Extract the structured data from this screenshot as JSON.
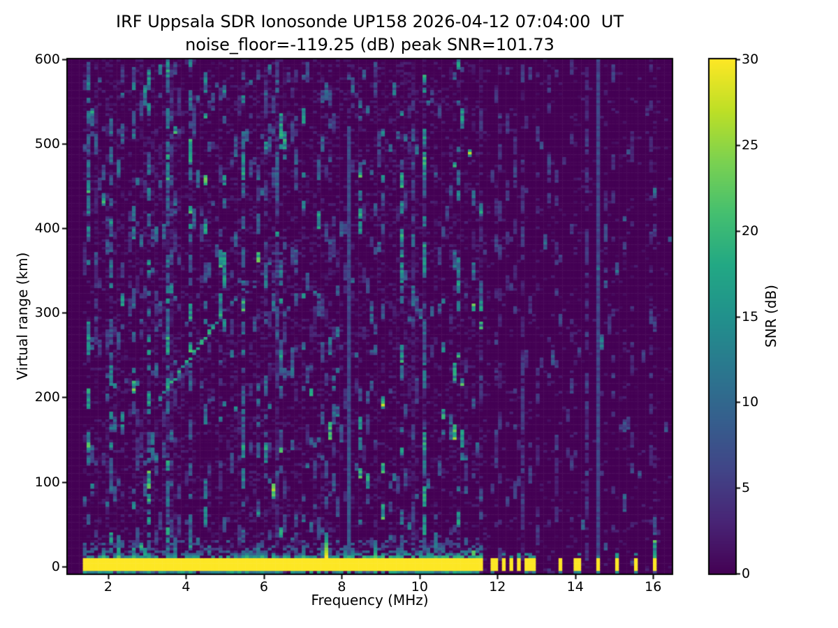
{
  "figure": {
    "background": "#ffffff",
    "text_color": "#000000"
  },
  "chart_data": {
    "type": "heatmap",
    "title": "IRF Uppsala SDR Ionosonde UP158 2026-04-12 07:04:00  UT",
    "subtitle": "noise_floor=-119.25 (dB) peak SNR=101.73",
    "noise_floor_db": -119.25,
    "peak_snr_db": 101.73,
    "xlabel": "Frequency (MHz)",
    "ylabel": "Virtual range (km)",
    "xlim": [
      0.96,
      16.48
    ],
    "ylim": [
      -8.5,
      600
    ],
    "x_ticks": [
      2,
      4,
      6,
      8,
      10,
      12,
      14,
      16
    ],
    "y_ticks": [
      0,
      100,
      200,
      300,
      400,
      500,
      600
    ],
    "grid": false,
    "colorbar": {
      "label": "SNR (dB)",
      "vmin": 0,
      "vmax": 30,
      "ticks": [
        0,
        5,
        10,
        15,
        20,
        25,
        30
      ],
      "position": "right"
    },
    "colormap": {
      "name": "viridis",
      "stops": [
        {
          "t": 0.0,
          "color": "#440154"
        },
        {
          "t": 0.1,
          "color": "#482475"
        },
        {
          "t": 0.2,
          "color": "#414487"
        },
        {
          "t": 0.3,
          "color": "#355f8d"
        },
        {
          "t": 0.4,
          "color": "#2a788e"
        },
        {
          "t": 0.5,
          "color": "#21918c"
        },
        {
          "t": 0.6,
          "color": "#22a884"
        },
        {
          "t": 0.7,
          "color": "#44bf70"
        },
        {
          "t": 0.8,
          "color": "#7ad151"
        },
        {
          "t": 0.9,
          "color": "#bddf26"
        },
        {
          "t": 1.0,
          "color": "#fde725"
        }
      ]
    },
    "features": {
      "description": "Ionogram: dark viridis noise field with speckled vertical interference streaks, saturated yellow ground-pulse band near 0 km, discrete transmit blocks above 11.6 MHz, oblique ionospheric echo trace, and narrow RFI lines.",
      "sweep_start_mhz": 1.35,
      "ground_pulse_band": {
        "f_range_mhz": [
          1.35,
          11.63
        ],
        "virtual_range_km": [
          -5.5,
          9
        ],
        "snr_db": 30
      },
      "band_fringe": {
        "f_range_mhz": [
          8.0,
          11.63
        ],
        "extends_to_km": 30
      },
      "bottom_edge_line_km": -7,
      "discrete_tx_blocks_mhz": [
        11.93,
        12.15,
        12.36,
        12.57,
        12.78,
        12.95,
        13.63,
        14.06,
        14.57,
        15.07,
        15.55,
        16.02
      ],
      "ground_spike": {
        "f_mhz": 7.63,
        "top_km": 40,
        "snr_db": 30
      },
      "echo_trace_points": [
        {
          "f_mhz": 3.3,
          "range_km": 196
        },
        {
          "f_mhz": 4.96,
          "range_km": 300
        },
        {
          "f_mhz": 6.62,
          "range_km": 382
        }
      ],
      "rfi_lines": [
        {
          "f_mhz": 8.17,
          "range_km": [
            0,
            520
          ],
          "snr_db": 8
        },
        {
          "f_mhz": 14.56,
          "range_km": [
            -5,
            600
          ],
          "snr_db": 9
        }
      ],
      "noisy_columns_mhz": [
        1.48,
        1.62,
        2.08,
        2.62,
        3.02,
        3.52,
        4.08,
        4.52,
        5.02,
        5.48,
        6.42,
        7.02,
        8.48,
        9.02,
        9.55,
        10.12,
        10.65,
        11.05
      ],
      "faint_dashed_columns_mhz": [
        12.02,
        12.22,
        12.42,
        12.62,
        12.82,
        13.02,
        13.35,
        13.55,
        13.95,
        14.3,
        15.0,
        15.45,
        15.95
      ]
    }
  }
}
